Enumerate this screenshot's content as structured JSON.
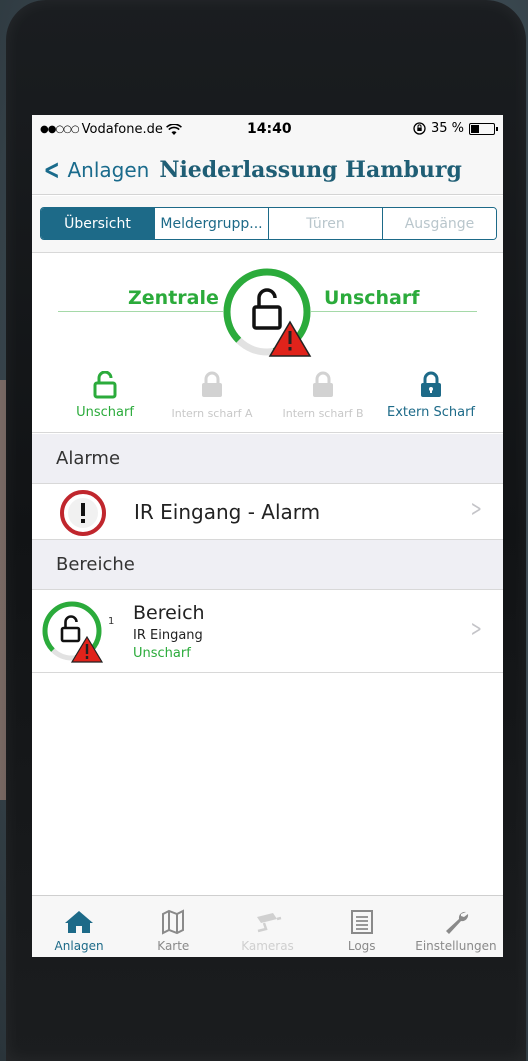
{
  "status": {
    "carrier": "Vodafone.de",
    "time": "14:40",
    "battery": "35 %"
  },
  "nav": {
    "back_label": "Anlagen",
    "title": "Niederlassung Hamburg"
  },
  "tabs_segment": [
    {
      "label": "Übersicht",
      "state": "active"
    },
    {
      "label": "Meldergrupp...",
      "state": "normal"
    },
    {
      "label": "Türen",
      "state": "disabled"
    },
    {
      "label": "Ausgänge",
      "state": "disabled"
    }
  ],
  "central": {
    "left_label": "Zentrale",
    "right_label": "Unscharf"
  },
  "modes": [
    {
      "label": "Unscharf",
      "color": "#2bab3b"
    },
    {
      "label": "Intern scharf A",
      "color": "#c8c8c8"
    },
    {
      "label": "Intern scharf B",
      "color": "#c8c8c8"
    },
    {
      "label": "Extern Scharf",
      "color": "#1d6a88"
    }
  ],
  "alarms": {
    "header": "Alarme",
    "item": "IR Eingang - Alarm"
  },
  "areas": {
    "header": "Bereiche",
    "item": {
      "title": "Bereich",
      "number": "1",
      "subtitle": "IR Eingang",
      "state": "Unscharf"
    }
  },
  "tabbar": [
    {
      "label": "Anlagen",
      "icon": "house-icon",
      "state": "active"
    },
    {
      "label": "Karte",
      "icon": "map-icon",
      "state": "normal"
    },
    {
      "label": "Kameras",
      "icon": "camera-icon",
      "state": "disabled"
    },
    {
      "label": "Logs",
      "icon": "list-icon",
      "state": "normal"
    },
    {
      "label": "Einstellungen",
      "icon": "wrench-icon",
      "state": "normal"
    }
  ],
  "colors": {
    "accent": "#1d6a88",
    "ok": "#2bab3b",
    "alarm": "#c0262d",
    "warning": "#e0231b"
  }
}
